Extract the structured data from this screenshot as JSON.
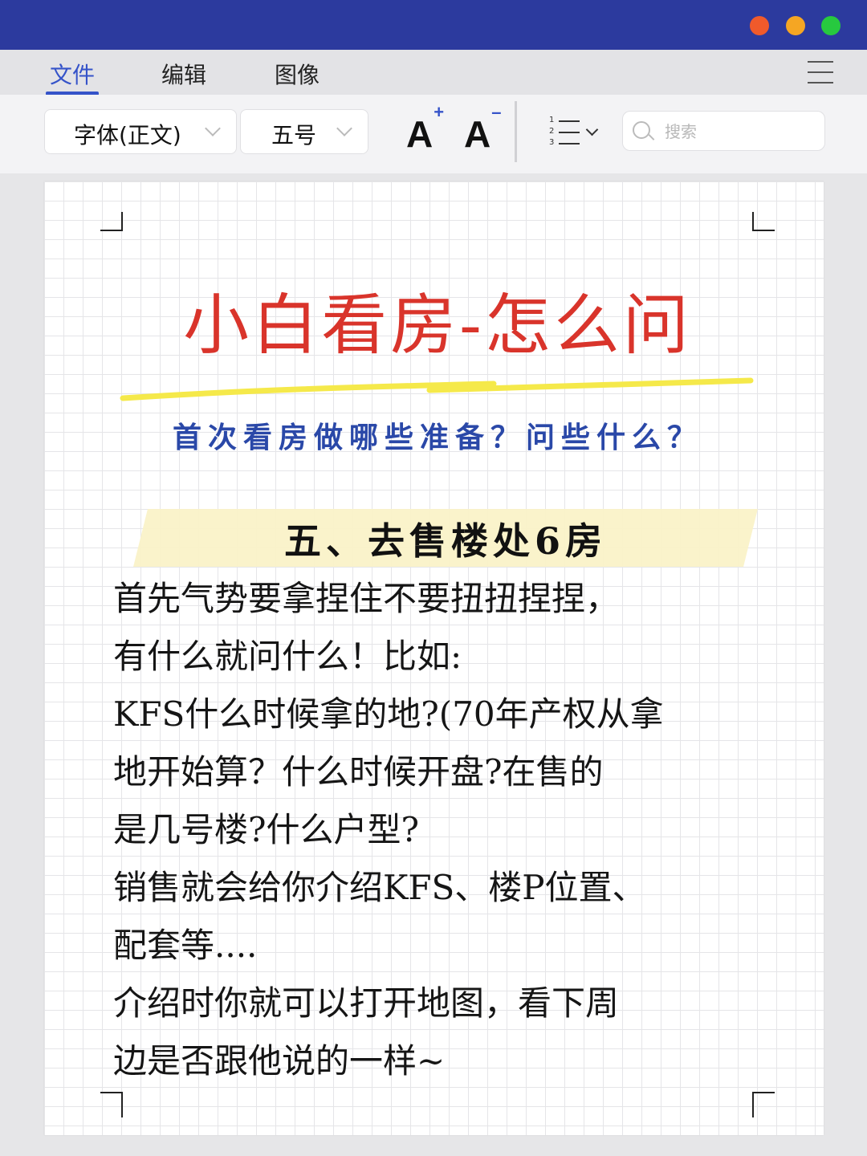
{
  "window": {
    "buttons": {
      "close_color": "#f05a2b",
      "minimize_color": "#f5a623",
      "maximize_color": "#27c93f"
    }
  },
  "menu": {
    "items": [
      "文件",
      "编辑",
      "图像"
    ],
    "active": "文件"
  },
  "toolbar": {
    "font_family": "字体(正文)",
    "font_size": "五号",
    "grow_font": "A",
    "shrink_font": "A",
    "list_numbers": [
      "1",
      "2",
      "3"
    ],
    "search_placeholder": "搜索"
  },
  "document": {
    "title": "小白看房-怎么问",
    "subtitle": "首次看房做哪些准备？问些什么？",
    "section_heading": "五、去售楼处6房",
    "body_lines": [
      "首先气势要拿捏住不要扭扭捏捏，",
      "有什么就问什么！比如:",
      "KFS什么时候拿的地?(70年产权从拿",
      "地开始算？什么时候开盘?在售的",
      "是几号楼?什么户型?",
      "销售就会给你介绍KFS、楼P位置、",
      "配套等....",
      "介绍时你就可以打开地图，看下周",
      "边是否跟他说的一样~"
    ]
  },
  "colors": {
    "accent": "#3553c9",
    "title_red": "#d9342b",
    "subtitle_blue": "#2a48a8",
    "highlight_yellow": "#f5e94a"
  }
}
